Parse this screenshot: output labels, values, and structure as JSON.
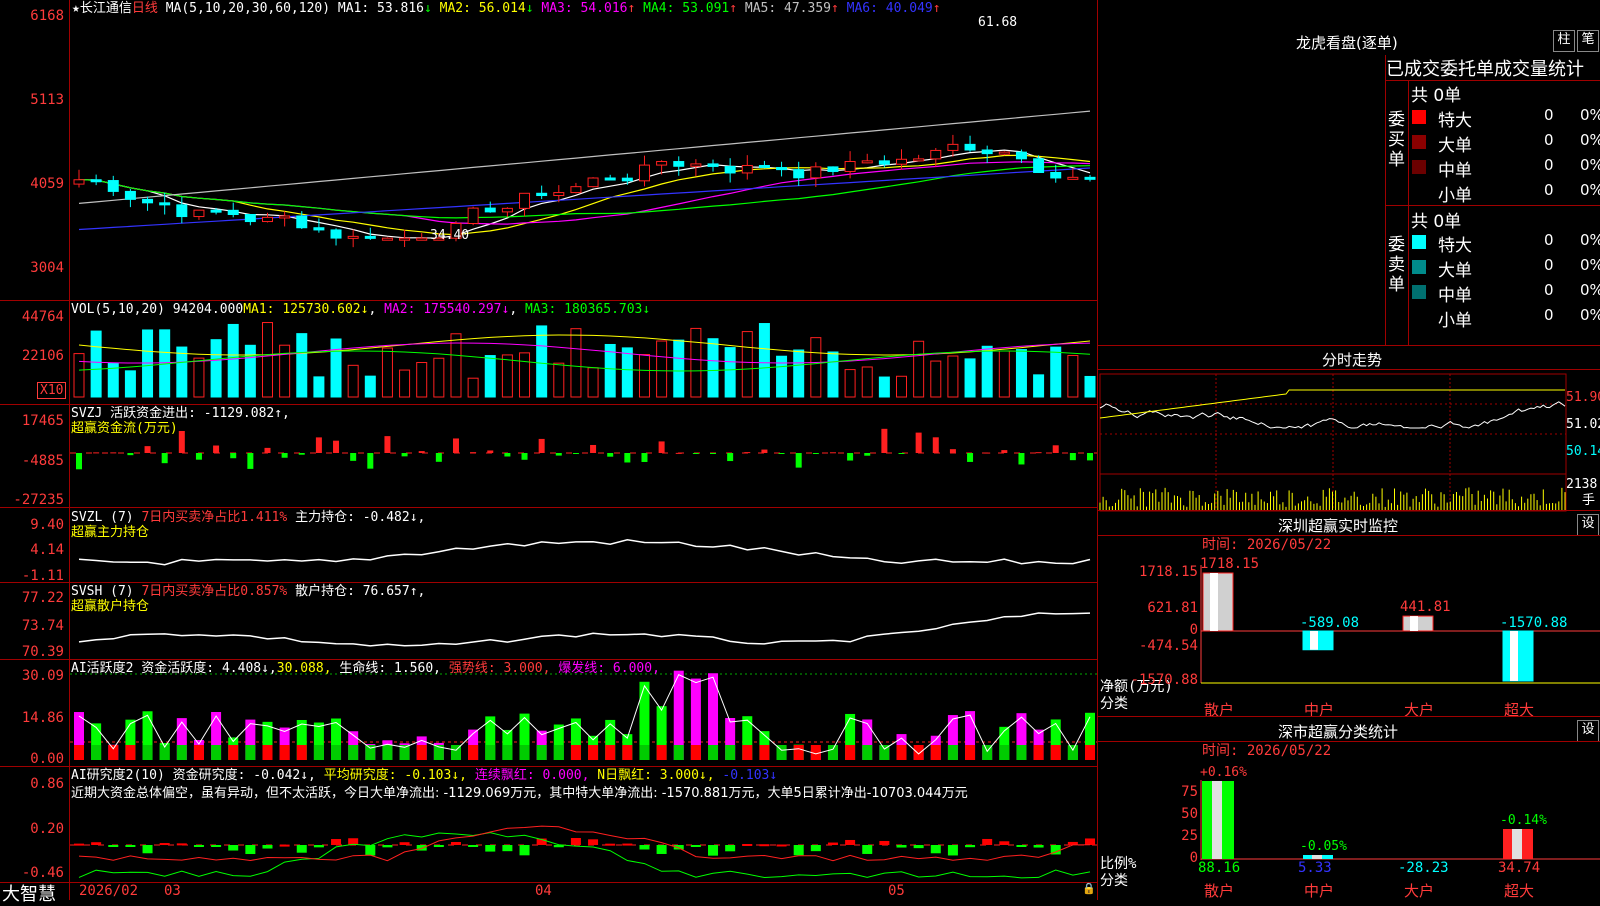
{
  "app": {
    "brand": "大智慧"
  },
  "kline": {
    "title": "长江通信",
    "period": "日线",
    "ma_params": "MA(5,10,20,30,60,120)",
    "ma": [
      {
        "name": "MA1",
        "value": "53.816",
        "arrow": "↓",
        "color": "#ffffff"
      },
      {
        "name": "MA2",
        "value": "56.014",
        "arrow": "↓",
        "color": "#ffff00"
      },
      {
        "name": "MA3",
        "value": "54.016",
        "arrow": "↑",
        "color": "#ff00ff"
      },
      {
        "name": "MA4",
        "value": "53.091",
        "arrow": "↑",
        "color": "#00ff00"
      },
      {
        "name": "MA5",
        "value": "47.359",
        "arrow": "↑",
        "color": "#c0c0c0"
      },
      {
        "name": "MA6",
        "value": "40.049",
        "arrow": "↑",
        "color": "#3333ff"
      }
    ],
    "y_ticks": [
      "6168",
      "5113",
      "4059",
      "3004"
    ],
    "high_label": "61.68",
    "low_label": "34.40"
  },
  "vol": {
    "label": "VOL(5,10,20)",
    "value": "94204.000",
    "ma1": "MA1: 125730.602↓",
    "ma2": "MA2: 175540.297↓",
    "ma3": "MA3: 180365.703↓",
    "y_ticks": [
      "44764",
      "22106"
    ],
    "unit": "X10"
  },
  "svzj": {
    "label": "SVZJ  活跃资金进出: -1129.082↑,",
    "sub": "超赢资金流(万元)",
    "y_ticks": [
      "17465",
      "-4885",
      "-27235"
    ]
  },
  "svzl": {
    "label1": "SVZL (7)",
    "label2": "7日内买卖净占比1.411%",
    "label3": "主力持仓: -0.482↓,",
    "sub": "超赢主力持仓",
    "y_ticks": [
      "9.40",
      "4.14",
      "-1.11"
    ]
  },
  "svsh": {
    "label1": "SVSH (7)",
    "label2": "7日内买卖净占比0.857%",
    "label3": "散户持仓: 76.657↑,",
    "sub": "超赢散户持仓",
    "y_ticks": [
      "77.22",
      "73.74",
      "70.39"
    ]
  },
  "ai1": {
    "label1": "AI活跃度2 资金活跃度: 4.408↓,",
    "label2": "30.088,",
    "label3": "生命线: 1.560,",
    "label4": "强势线: 3.000,",
    "label5": "爆发线: 6.000,",
    "y_ticks": [
      "30.09",
      "14.86",
      "0.00"
    ]
  },
  "ai2": {
    "label1": "AI研究度2(10) 资金研究度: -0.042↓,",
    "label2": "平均研究度: -0.103↓,",
    "label3": "连续飘红: 0.000,",
    "label4": "N日飘红: 3.000↓,",
    "label5": "-0.103↓",
    "comment": "近期大资金总体偏空，虽有异动，但不太活跃，今日大单净流出: -1129.069万元，其中特大单净流出: -1570.881万元，大单5日累计净出-10703.044万元",
    "y_ticks": [
      "0.86",
      "0.20",
      "-0.46"
    ]
  },
  "xaxis": {
    "labels": [
      "2026/02",
      "03",
      "04",
      "05"
    ]
  },
  "right": {
    "lhb_title": "龙虎看盘(逐单)",
    "btn_zhu": "柱",
    "btn_bi": "笔",
    "stats_title": "已成交委托单成交量统计",
    "buy_label": "委买单",
    "sell_label": "委卖单",
    "buy_total": "共 0单",
    "sell_total": "共 0单",
    "buy_rows": [
      {
        "name": "特大",
        "count": "0",
        "pct": "0%",
        "color": "#ff0000"
      },
      {
        "name": "大单",
        "count": "0",
        "pct": "0%",
        "color": "#8b0000"
      },
      {
        "name": "中单",
        "count": "0",
        "pct": "0%",
        "color": "#6b0000"
      },
      {
        "name": "小单",
        "count": "0",
        "pct": "0%",
        "color": ""
      }
    ],
    "sell_rows": [
      {
        "name": "特大",
        "count": "0",
        "pct": "0%",
        "color": "#00ffff"
      },
      {
        "name": "大单",
        "count": "0",
        "pct": "0%",
        "color": "#008b8b"
      },
      {
        "name": "中单",
        "count": "0",
        "pct": "0%",
        "color": "#007070"
      },
      {
        "name": "小单",
        "count": "0",
        "pct": "0%",
        "color": ""
      }
    ],
    "fenshi_title": "分时走势",
    "fenshi_y": [
      "51.90",
      "51.02",
      "50.14"
    ],
    "fenshi_vol": "2138",
    "fenshi_vol_unit": "手",
    "sz_monitor": {
      "title": "深圳超赢实时监控",
      "btn": "设",
      "time": "时间: 2026/05/22",
      "y_ticks": [
        "1718.15",
        "621.81",
        "0",
        "-474.54",
        "-1570.88"
      ],
      "unit1": "净额(万元)",
      "unit2": "分类",
      "categories": [
        "散户",
        "中户",
        "大户",
        "超大"
      ],
      "values": [
        "1718.15",
        "-589.08",
        "441.81",
        "-1570.88"
      ]
    },
    "sz_class": {
      "title": "深市超赢分类统计",
      "btn": "设",
      "time": "时间: 2026/05/22",
      "y_ticks": [
        "75",
        "50",
        "25",
        "0"
      ],
      "unit1": "比例%",
      "unit2": "分类",
      "categories": [
        "散户",
        "中户",
        "大户",
        "超大"
      ],
      "pct_change": [
        "+0.16%",
        "-0.05%",
        "",
        "-0.14%"
      ],
      "values": [
        "88.16",
        "5.33",
        "-28.23",
        "34.74"
      ]
    }
  }
}
